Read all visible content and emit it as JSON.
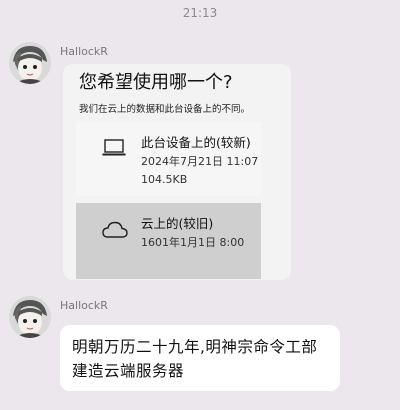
{
  "status": {
    "time": "21:13"
  },
  "messages": [
    {
      "sender": "HallockR",
      "type": "image",
      "dialog": {
        "title": "您希望使用哪一个?",
        "subtitle": "我们在云上的数据和此台设备上的不同。",
        "options": [
          {
            "icon": "laptop-icon",
            "name": "此台设备上的(较新)",
            "date": "2024年7月21日 11:07",
            "size": "104.5KB"
          },
          {
            "icon": "cloud-icon",
            "name": "云上的(较旧)",
            "date": "1601年1月1日 8:00"
          }
        ]
      }
    },
    {
      "sender": "HallockR",
      "type": "text",
      "text": "明朝万历二十九年,明神宗命令工部建造云端服务器"
    }
  ]
}
